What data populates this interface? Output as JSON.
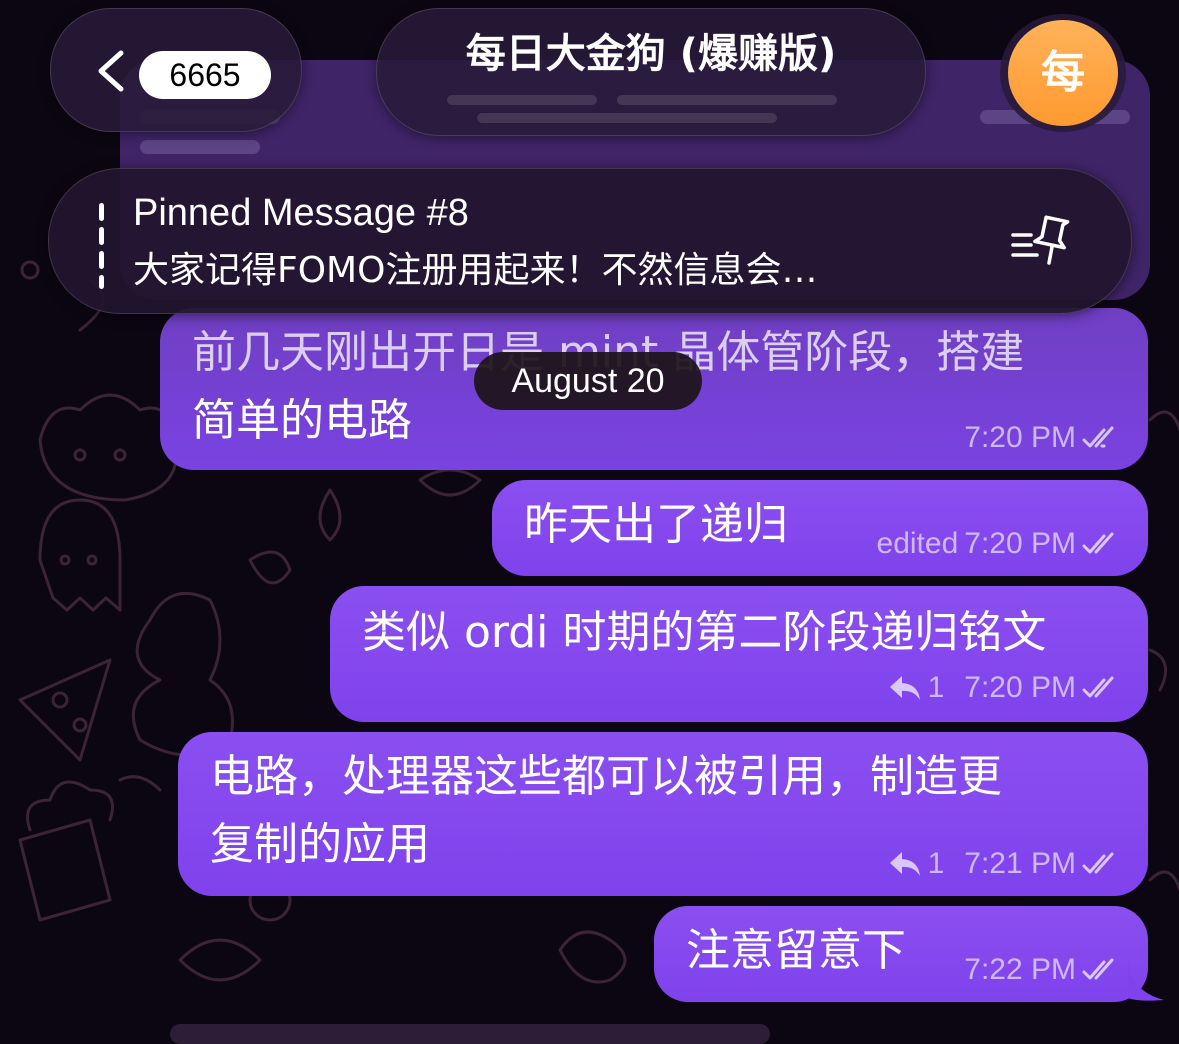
{
  "header": {
    "back_label": "back",
    "unread_count": "6665",
    "chat_title": "每日大金狗 (爆赚版)",
    "avatar_letter": "每",
    "avatar_color": "#ff9f38"
  },
  "pinned": {
    "title": "Pinned Message #8",
    "text": "大家记得FOMO注册用起来！不然信息会…",
    "icon": "pin-list-icon"
  },
  "date_chip": "August 20",
  "messages": [
    {
      "lines": [
        "前几天刚出开日是 mint 晶体管阶段，搭建",
        "简单的电路"
      ],
      "time": "7:20 PM",
      "edited": "",
      "replies": ""
    },
    {
      "lines": [
        "昨天出了递归"
      ],
      "time": "7:20 PM",
      "edited": "edited",
      "replies": ""
    },
    {
      "lines": [
        "类似 ordi 时期的第二阶段递归铭文"
      ],
      "time": "7:20 PM",
      "edited": "",
      "replies": "1"
    },
    {
      "lines": [
        "电路，处理器这些都可以被引用，制造更",
        "复制的应用"
      ],
      "time": "7:21 PM",
      "edited": "",
      "replies": "1"
    },
    {
      "lines": [
        "注意留意下"
      ],
      "time": "7:22 PM",
      "edited": "",
      "replies": ""
    }
  ],
  "colors": {
    "bubble": "#8349ee",
    "background": "#0c0612",
    "header_pill": "#281a38"
  }
}
